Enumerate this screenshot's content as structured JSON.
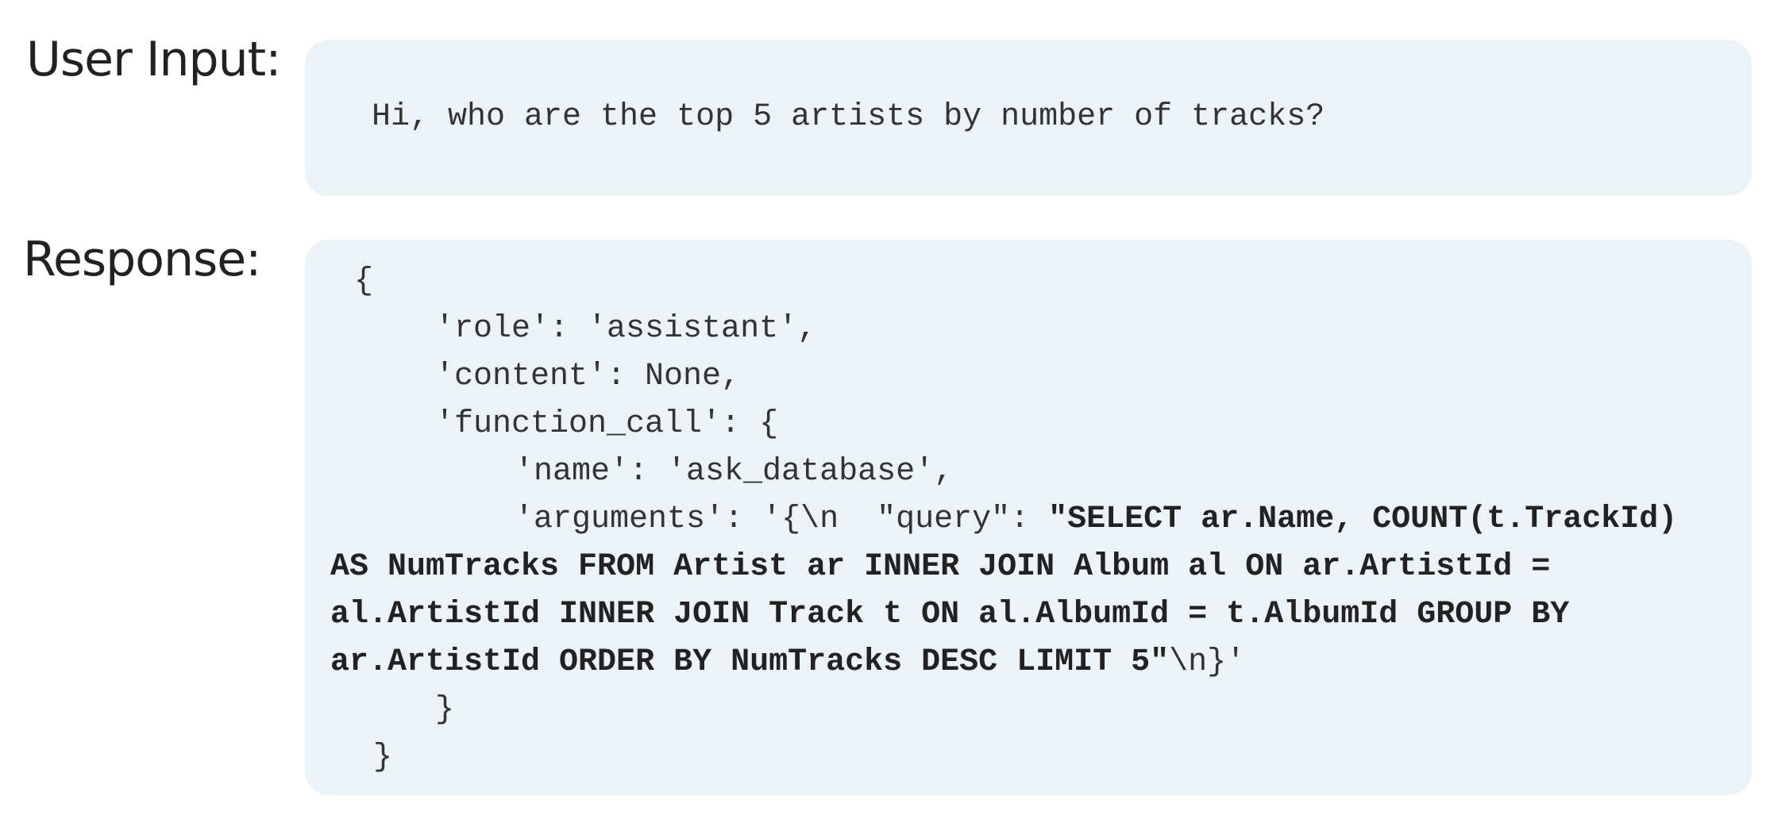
{
  "user_input": {
    "label": "User Input:",
    "text": "Hi, who are the top 5 artists by number of tracks?"
  },
  "response": {
    "label": "Response:",
    "open_brace": "{",
    "role_line": "'role': 'assistant',",
    "content_line": "'content': None,",
    "function_call_line": "'function_call': {",
    "name_line": "'name': 'ask_database',",
    "arguments_prefix": "'arguments': '{\\n  \"query\": ",
    "sql_lines": [
      "\"SELECT ar.Name, COUNT(t.TrackId)",
      "AS NumTracks FROM Artist ar INNER JOIN Album al ON ar.ArtistId =",
      "al.ArtistId INNER JOIN Track t ON al.AlbumId = t.AlbumId GROUP BY",
      "ar.ArtistId ORDER BY NumTracks DESC LIMIT 5\""
    ],
    "arguments_suffix": "\\n}'",
    "inner_close_brace": "}",
    "outer_close_brace": "}"
  }
}
